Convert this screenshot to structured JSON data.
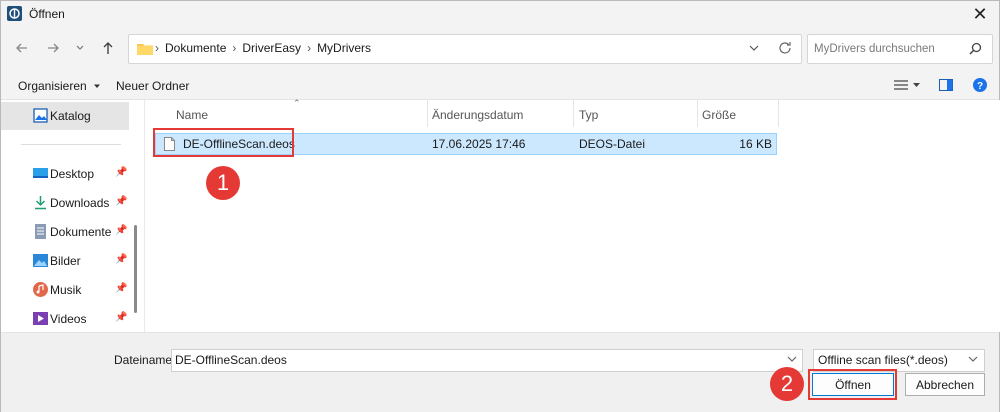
{
  "window": {
    "title": "Öffnen",
    "close_glyph": "✕"
  },
  "address": {
    "crumbs": [
      "Dokumente",
      "DriverEasy",
      "MyDrivers"
    ],
    "separator": "›"
  },
  "search": {
    "placeholder": "MyDrivers durchsuchen"
  },
  "toolbar": {
    "organize_label": "Organisieren",
    "new_folder_label": "Neuer Ordner"
  },
  "sidebar": {
    "items": [
      {
        "label": "Katalog",
        "icon": "gallery-icon",
        "pinned": false
      },
      {
        "label": "Desktop",
        "icon": "desktop-icon",
        "pinned": true
      },
      {
        "label": "Downloads",
        "icon": "download-icon",
        "pinned": true
      },
      {
        "label": "Dokumente",
        "icon": "documents-icon",
        "pinned": true
      },
      {
        "label": "Bilder",
        "icon": "pictures-icon",
        "pinned": true
      },
      {
        "label": "Musik",
        "icon": "music-icon",
        "pinned": true
      },
      {
        "label": "Videos",
        "icon": "videos-icon",
        "pinned": true
      }
    ]
  },
  "columns": [
    "Name",
    "Änderungsdatum",
    "Typ",
    "Größe"
  ],
  "files": [
    {
      "name": "DE-OfflineScan.deos",
      "modified": "17.06.2025 17:46",
      "type": "DEOS-Datei",
      "size": "16 KB",
      "selected": true
    }
  ],
  "bottom": {
    "filename_label": "Dateiname:",
    "filename_value": "DE-OfflineScan.deos",
    "filter_value": "Offline scan files(*.deos)",
    "open_label": "Öffnen",
    "cancel_label": "Abbrechen"
  },
  "annotations": {
    "badge1": "1",
    "badge2": "2"
  },
  "colors": {
    "highlight": "#e53935",
    "selection": "#cce8ff",
    "accent": "#0078d4"
  }
}
